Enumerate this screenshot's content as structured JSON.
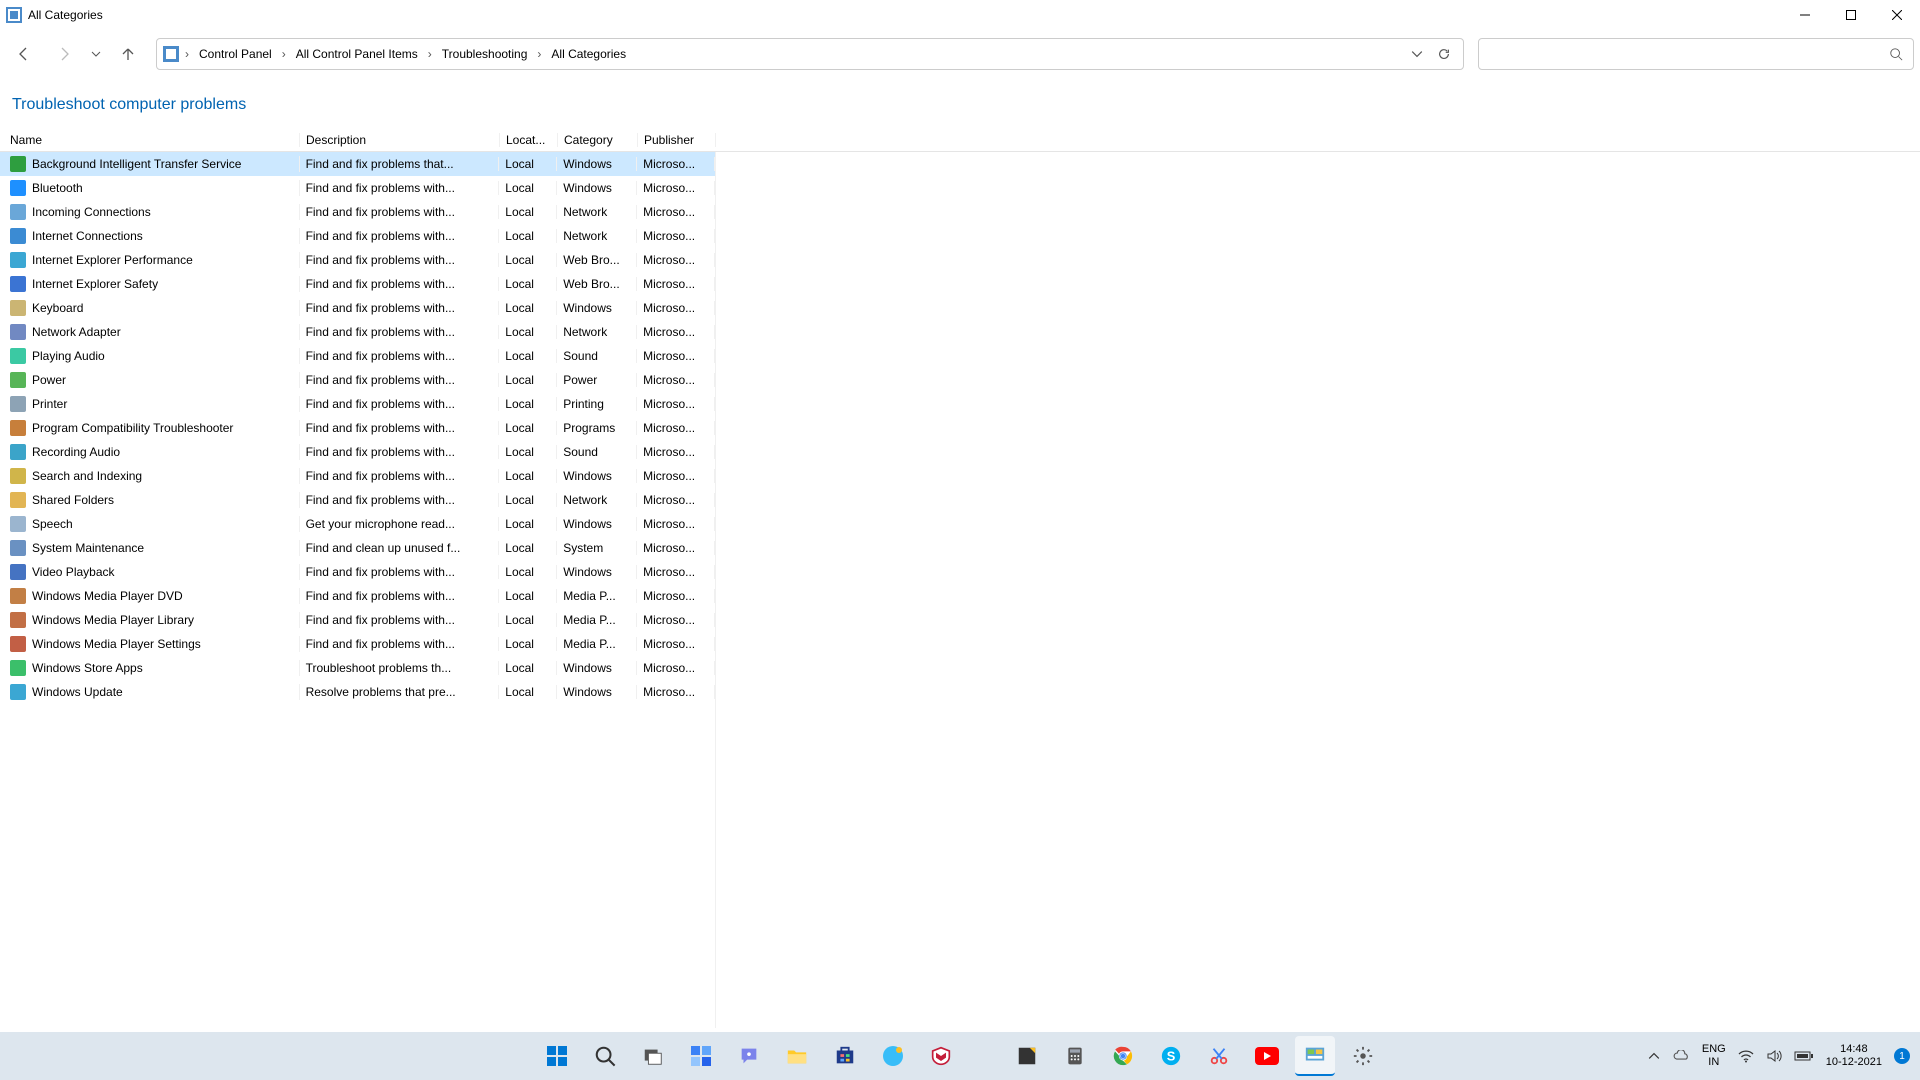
{
  "window": {
    "title": "All Categories"
  },
  "breadcrumb": [
    "Control Panel",
    "All Control Panel Items",
    "Troubleshooting",
    "All Categories"
  ],
  "heading": "Troubleshoot computer problems",
  "columns": {
    "name": "Name",
    "desc": "Description",
    "loc": "Locat...",
    "cat": "Category",
    "pub": "Publisher"
  },
  "rows": [
    {
      "name": "Background Intelligent Transfer Service",
      "desc": "Find and fix problems that...",
      "loc": "Local",
      "cat": "Windows",
      "pub": "Microso...",
      "icon": "#2e9e3f",
      "selected": true
    },
    {
      "name": "Bluetooth",
      "desc": "Find and fix problems with...",
      "loc": "Local",
      "cat": "Windows",
      "pub": "Microso...",
      "icon": "#1e90ff"
    },
    {
      "name": "Incoming Connections",
      "desc": "Find and fix problems with...",
      "loc": "Local",
      "cat": "Network",
      "pub": "Microso...",
      "icon": "#6aa7d8"
    },
    {
      "name": "Internet Connections",
      "desc": "Find and fix problems with...",
      "loc": "Local",
      "cat": "Network",
      "pub": "Microso...",
      "icon": "#3b8bd3"
    },
    {
      "name": "Internet Explorer Performance",
      "desc": "Find and fix problems with...",
      "loc": "Local",
      "cat": "Web Bro...",
      "pub": "Microso...",
      "icon": "#3ba7d3"
    },
    {
      "name": "Internet Explorer Safety",
      "desc": "Find and fix problems with...",
      "loc": "Local",
      "cat": "Web Bro...",
      "pub": "Microso...",
      "icon": "#3b74d3"
    },
    {
      "name": "Keyboard",
      "desc": "Find and fix problems with...",
      "loc": "Local",
      "cat": "Windows",
      "pub": "Microso...",
      "icon": "#cbb573"
    },
    {
      "name": "Network Adapter",
      "desc": "Find and fix problems with...",
      "loc": "Local",
      "cat": "Network",
      "pub": "Microso...",
      "icon": "#7189c2"
    },
    {
      "name": "Playing Audio",
      "desc": "Find and fix problems with...",
      "loc": "Local",
      "cat": "Sound",
      "pub": "Microso...",
      "icon": "#3bc9a3"
    },
    {
      "name": "Power",
      "desc": "Find and fix problems with...",
      "loc": "Local",
      "cat": "Power",
      "pub": "Microso...",
      "icon": "#57b557"
    },
    {
      "name": "Printer",
      "desc": "Find and fix problems with...",
      "loc": "Local",
      "cat": "Printing",
      "pub": "Microso...",
      "icon": "#8da3b5"
    },
    {
      "name": "Program Compatibility Troubleshooter",
      "desc": "Find and fix problems with...",
      "loc": "Local",
      "cat": "Programs",
      "pub": "Microso...",
      "icon": "#c77f3b"
    },
    {
      "name": "Recording Audio",
      "desc": "Find and fix problems with...",
      "loc": "Local",
      "cat": "Sound",
      "pub": "Microso...",
      "icon": "#3ba4c9"
    },
    {
      "name": "Search and Indexing",
      "desc": "Find and fix problems with...",
      "loc": "Local",
      "cat": "Windows",
      "pub": "Microso...",
      "icon": "#d0b54a"
    },
    {
      "name": "Shared Folders",
      "desc": "Find and fix problems with...",
      "loc": "Local",
      "cat": "Network",
      "pub": "Microso...",
      "icon": "#e2b554"
    },
    {
      "name": "Speech",
      "desc": "Get your microphone read...",
      "loc": "Local",
      "cat": "Windows",
      "pub": "Microso...",
      "icon": "#9bb5cf"
    },
    {
      "name": "System Maintenance",
      "desc": "Find and clean up unused f...",
      "loc": "Local",
      "cat": "System",
      "pub": "Microso...",
      "icon": "#6a91c2"
    },
    {
      "name": "Video Playback",
      "desc": "Find and fix problems with...",
      "loc": "Local",
      "cat": "Windows",
      "pub": "Microso...",
      "icon": "#4573c2"
    },
    {
      "name": "Windows Media Player DVD",
      "desc": "Find and fix problems with...",
      "loc": "Local",
      "cat": "Media P...",
      "pub": "Microso...",
      "icon": "#c27f45"
    },
    {
      "name": "Windows Media Player Library",
      "desc": "Find and fix problems with...",
      "loc": "Local",
      "cat": "Media P...",
      "pub": "Microso...",
      "icon": "#c26f45"
    },
    {
      "name": "Windows Media Player Settings",
      "desc": "Find and fix problems with...",
      "loc": "Local",
      "cat": "Media P...",
      "pub": "Microso...",
      "icon": "#c25f45"
    },
    {
      "name": "Windows Store Apps",
      "desc": "Troubleshoot problems th...",
      "loc": "Local",
      "cat": "Windows",
      "pub": "Microso...",
      "icon": "#3bbf6a"
    },
    {
      "name": "Windows Update",
      "desc": "Resolve problems that pre...",
      "loc": "Local",
      "cat": "Windows",
      "pub": "Microso...",
      "icon": "#3ba7d3"
    }
  ],
  "tray": {
    "lang1": "ENG",
    "lang2": "IN",
    "time": "14:48",
    "date": "10-12-2021",
    "notif": "1"
  }
}
